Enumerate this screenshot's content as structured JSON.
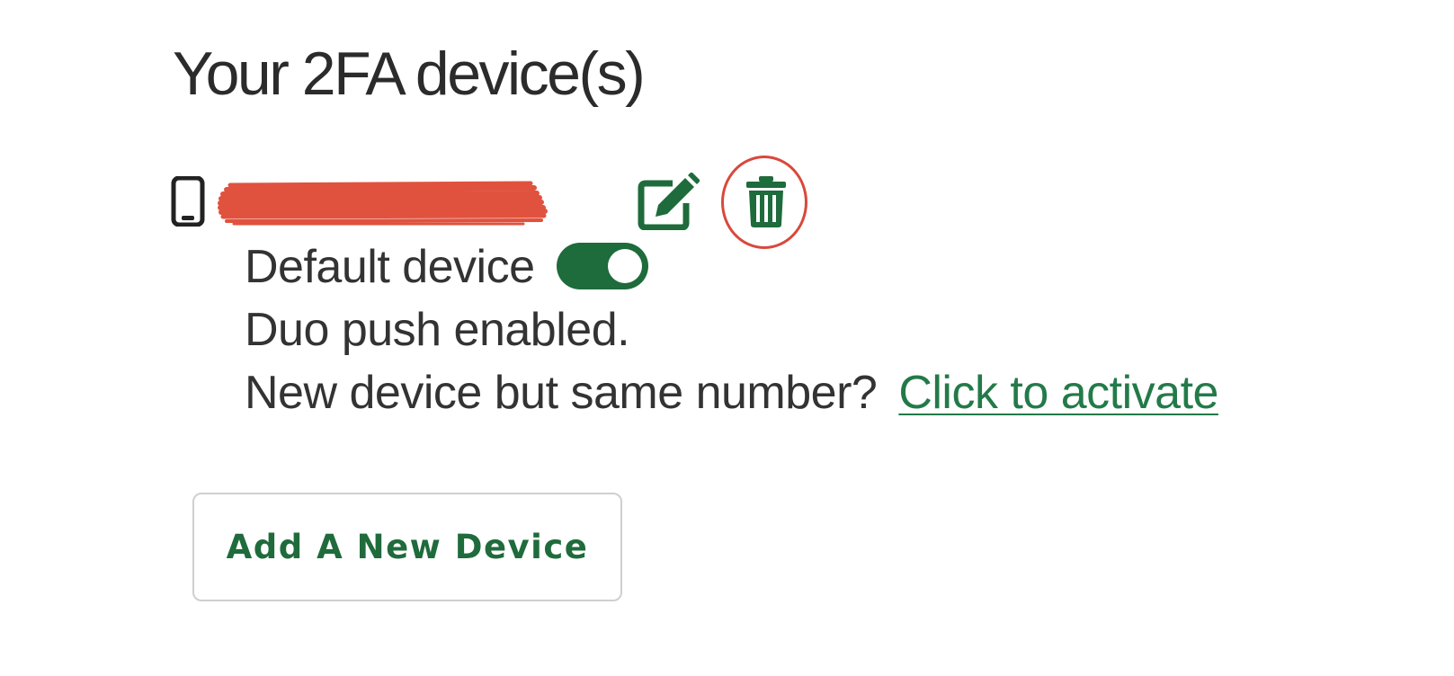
{
  "heading": "Your 2FA device(s)",
  "device": {
    "type_icon": "mobile-phone-icon",
    "name_redacted": true,
    "actions": {
      "edit_icon": "edit-square-pen-icon",
      "delete_icon": "trash-can-icon"
    },
    "default_label": "Default device",
    "default_enabled": true,
    "push_status": "Duo push enabled.",
    "new_device_prompt": "New device but same number?",
    "activate_link": "Click to activate"
  },
  "add_button_label": "Add A New Device",
  "colors": {
    "accent_green": "#1e6b3c",
    "link_green": "#237a49",
    "highlight_red": "#d9483b",
    "redaction_red": "#e0523e",
    "text": "#333333"
  }
}
